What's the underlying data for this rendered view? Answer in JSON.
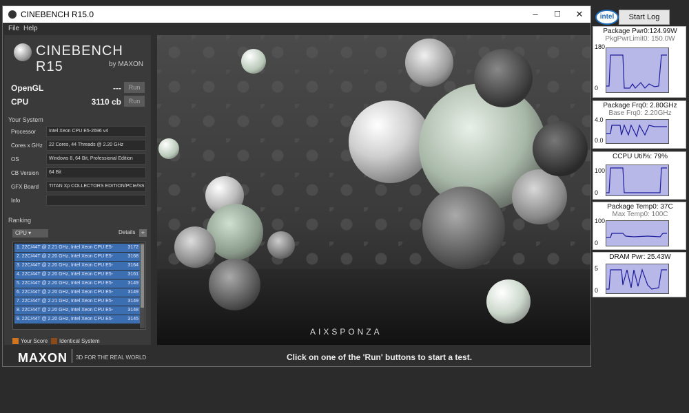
{
  "window": {
    "title": "CINEBENCH R15.0",
    "min": "–",
    "max": "☐",
    "close": "✕"
  },
  "menu": {
    "file": "File",
    "help": "Help"
  },
  "logo": {
    "name": "CINEBENCH R15",
    "sub": "by MAXON"
  },
  "bench": {
    "opengl": {
      "label": "OpenGL",
      "value": "---",
      "run": "Run"
    },
    "cpu": {
      "label": "CPU",
      "value": "3110 cb",
      "run": "Run"
    }
  },
  "system": {
    "heading": "Your System",
    "rows": [
      {
        "key": "Processor",
        "value": "Intel Xeon CPU E5-2696 v4"
      },
      {
        "key": "Cores x GHz",
        "value": "22 Cores, 44 Threads @ 2.20 GHz"
      },
      {
        "key": "OS",
        "value": "Windows 8, 64 Bit, Professional Edition"
      },
      {
        "key": "CB Version",
        "value": "64 Bit"
      },
      {
        "key": "GFX Board",
        "value": "TITAN Xp COLLECTORS EDITION/PCIe/SS"
      },
      {
        "key": "Info",
        "value": ""
      }
    ]
  },
  "ranking": {
    "heading": "Ranking",
    "dropdown": "CPU",
    "details": "Details",
    "details_btn": "+",
    "items": [
      {
        "name": "1. 22C/44T @ 2.21 GHz, Intel Xeon CPU E5-",
        "score": "3172"
      },
      {
        "name": "2. 22C/44T @ 2.20 GHz, Intel Xeon CPU E5-",
        "score": "3168"
      },
      {
        "name": "3. 22C/44T @ 2.20 GHz, Intel Xeon CPU E5-",
        "score": "3164"
      },
      {
        "name": "4. 22C/44T @ 2.20 GHz, Intel Xeon CPU E5-",
        "score": "3161"
      },
      {
        "name": "5. 22C/44T @ 2.20 GHz, Intel Xeon CPU E5-",
        "score": "3149"
      },
      {
        "name": "6. 22C/44T @ 2.20 GHz, Intel Xeon CPU E5-",
        "score": "3149"
      },
      {
        "name": "7. 22C/44T @ 2.21 GHz, Intel Xeon CPU E5-",
        "score": "3149"
      },
      {
        "name": "8. 22C/44T @ 2.20 GHz, Intel Xeon CPU E5-",
        "score": "3148"
      },
      {
        "name": "9. 22C/44T @ 2.20 GHz, Intel Xeon CPU E5-",
        "score": "3145"
      }
    ],
    "legend_your": "Your Score",
    "legend_identical": "Identical System",
    "color_your": "#d0741e",
    "color_identical": "#8a4a1a",
    "selected_color": "#3b6fb1"
  },
  "render": {
    "brand": "AIXSPONZA"
  },
  "bottom": {
    "maxon": "MAXON",
    "tagline": "3D FOR THE REAL WORLD",
    "status": "Click on one of the 'Run' buttons to start a test."
  },
  "gadget": {
    "logo": "intel",
    "start_log": "Start Log",
    "panels": [
      {
        "t1": "Package Pwr0:124.99W",
        "t2": "PkgPwrLimit0: 150.0W",
        "ymax": "180",
        "ymin": "0"
      },
      {
        "t1": "Package Frq0: 2.80GHz",
        "t2": "Base Frq0: 2.20GHz",
        "ymax": "4.0",
        "ymin": "0.0"
      },
      {
        "t1": "CCPU Util%: 79%",
        "t2": "",
        "ymax": "100",
        "ymin": "0"
      },
      {
        "t1": "Package Temp0: 37C",
        "t2": "Max Temp0: 100C",
        "ymax": "100",
        "ymin": "0"
      },
      {
        "t1": "DRAM Pwr: 25.43W",
        "t2": "",
        "ymax": "5",
        "ymin": "0"
      }
    ]
  }
}
